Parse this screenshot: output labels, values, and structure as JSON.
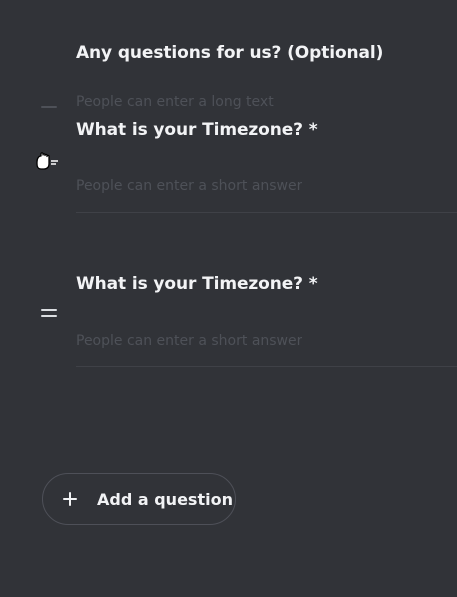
{
  "questions": [
    {
      "title": "Any questions for us? (Optional)",
      "placeholder": "People can enter a long text"
    },
    {
      "title": "What is your Timezone? *",
      "placeholder": "People can enter a short answer"
    },
    {
      "title": "What is your Timezone? *",
      "placeholder": "People can enter a short answer"
    }
  ],
  "add_question": {
    "label": "Add a question",
    "icon": "plus-icon"
  },
  "icons": {
    "drag": "drag-handle-icon",
    "cursor": "grab-hand-cursor-icon"
  },
  "colors": {
    "background": "#313338",
    "text": "#f2f3f5",
    "hint": "#4e5158"
  }
}
